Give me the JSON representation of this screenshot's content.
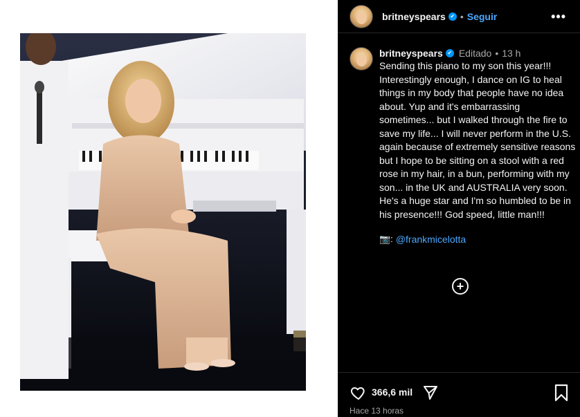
{
  "post": {
    "username": "britneyspears",
    "follow_label": "Seguir",
    "more_label": "•••",
    "edited_label": "Editado",
    "time_ago": "13 h",
    "dot": "•",
    "caption": "Sending this piano to my son this year!!! Interestingly enough, I dance on IG to heal things in my body that people have no idea about. Yup and it's embarrassing sometimes... but I walked through the fire to save my life... I will never perform in the U.S. again because of extremely sensitive reasons but I hope to be sitting on a stool with a red rose in my hair, in a bun, performing with my son... in the UK and AUSTRALIA very soon. He's a huge star and I'm so humbled to be in his presence!!! God speed, little man!!!",
    "credit_emoji": "📷:",
    "credit_handle": "@frankmicelotta",
    "load_more_icon": "+",
    "like_count": "366,6 mil",
    "post_age": "Hace 13 horas"
  },
  "icons": {
    "verified": "verified-badge-icon",
    "more": "more-options-icon",
    "like": "heart-icon",
    "share": "paper-plane-icon",
    "save": "bookmark-icon",
    "load_more": "plus-circle-icon",
    "camera": "camera-icon"
  },
  "colors": {
    "panel_bg": "#000000",
    "accent_blue": "#4aa8ff",
    "verified_blue": "#0095f6",
    "muted_text": "#a8a8a8"
  }
}
